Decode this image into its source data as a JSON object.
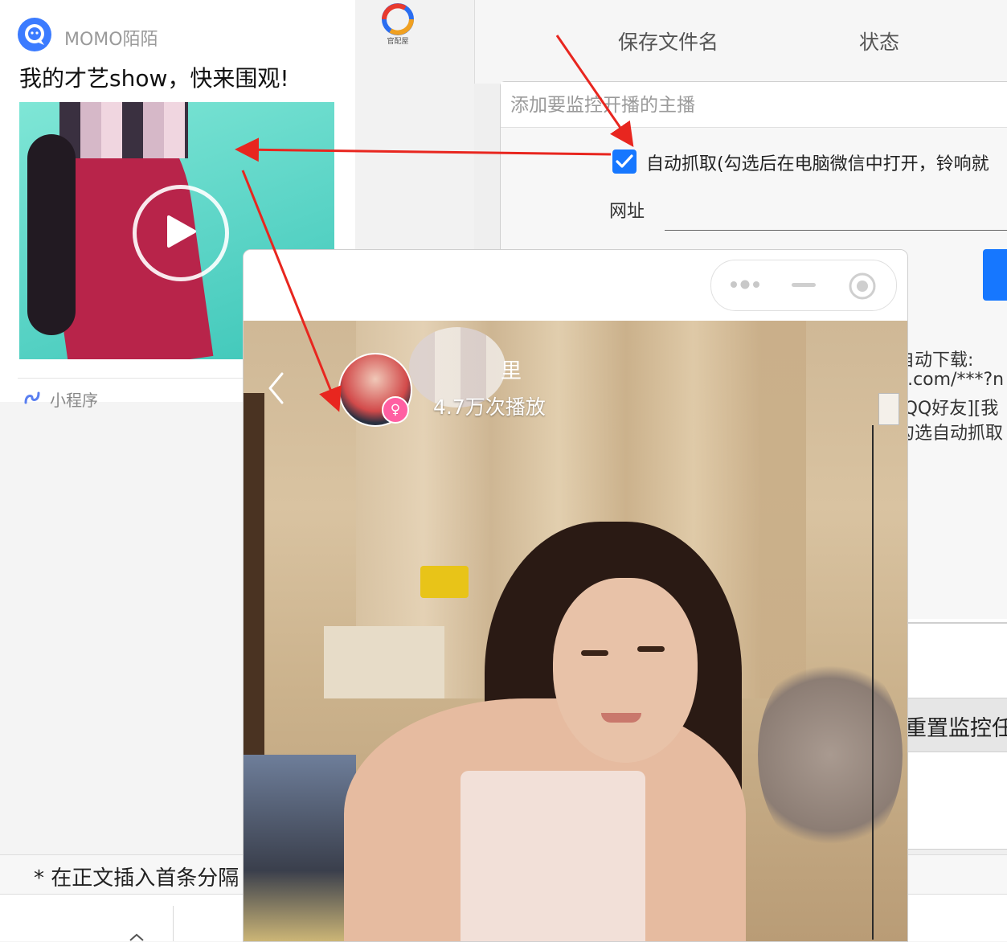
{
  "chat": {
    "app_name": "MOMO陌陌",
    "post_title": "我的才艺show，快来围观!",
    "mini_program_label": "小程序",
    "watermark_text": "官配屋"
  },
  "app": {
    "col_filename": "保存文件名",
    "col_status": "状态",
    "add_placeholder": "添加要监控开播的主播",
    "auto_capture_label": "自动抓取(勾选后在电脑微信中打开，铃响就",
    "auto_capture_checked": true,
    "url_label": "网址",
    "desc_lines": [
      "自动下载:",
      "o.com/***?n",
      "[QQ好友][我",
      "勾选自动抓取"
    ],
    "reset_label": "重置监控任",
    "bottom_note": "* 在正文插入首条分隔"
  },
  "mini_program": {
    "plays_text": "4.7万次播放",
    "name_fragment": "里",
    "gender_symbol": "♀"
  },
  "colors": {
    "accent_blue": "#1677ff",
    "arrow_red": "#e8261f",
    "badge_pink": "#ff5fa2"
  }
}
